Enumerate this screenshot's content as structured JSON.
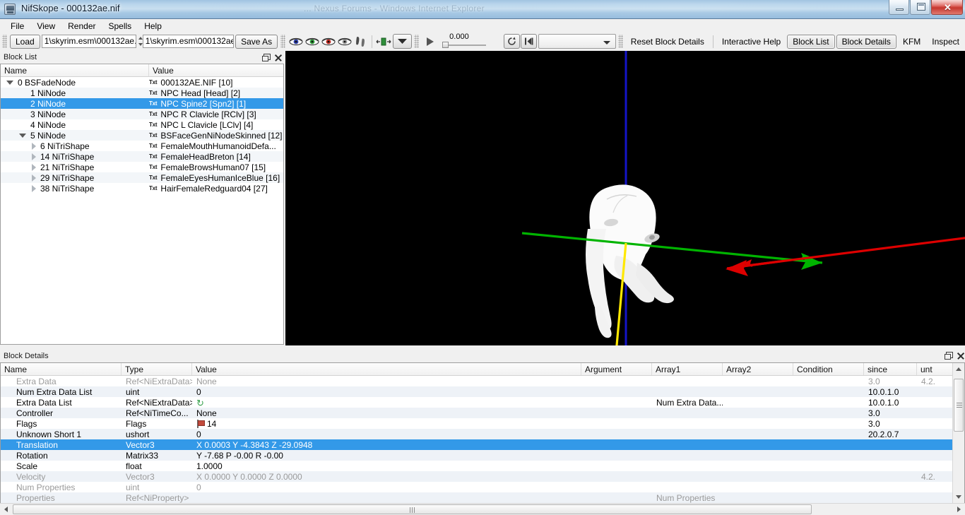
{
  "window": {
    "title": "NifSkope - 000132ae.nif",
    "ghost_text_1": "... Nexus Forums - Windows Internet Explorer",
    "minimize_label": "Minimize",
    "maximize_label": "Restore",
    "close_label": "✕"
  },
  "menubar": {
    "items": [
      {
        "label": "File"
      },
      {
        "label": "View"
      },
      {
        "label": "Render"
      },
      {
        "label": "Spells"
      },
      {
        "label": "Help"
      }
    ]
  },
  "toolbar": {
    "load_label": "Load",
    "path_field_1": "1\\skyrim.esm\\000132ae.nif",
    "path_field_2": "1\\skyrim.esm\\000132ae.nif",
    "saveas_label": "Save As",
    "anim_value": "0.000",
    "anim_combo_value": "",
    "reset_block_details_label": "Reset Block Details",
    "interactive_help_label": "Interactive Help",
    "block_list_label": "Block List",
    "block_details_label": "Block Details",
    "kfm_label": "KFM",
    "inspect_label": "Inspect",
    "icons": [
      "eye-blue-icon",
      "eye-green-icon",
      "eye-red-icon",
      "eye-gray-icon",
      "footsteps-icon",
      "axes-center-icon",
      "dropdown-arrow-icon",
      "play-icon",
      "loop-icon",
      "playpause-icon"
    ]
  },
  "block_list": {
    "panel_title": "Block List",
    "columns": [
      "Name",
      "Value"
    ],
    "rows": [
      {
        "indent": 0,
        "toggle": "open",
        "name": "0 BSFadeNode",
        "value": "000132AE.NIF [10]",
        "badge": "Txt",
        "selected": false
      },
      {
        "indent": 1,
        "toggle": "none",
        "name": "1 NiNode",
        "value": "NPC Head [Head] [2]",
        "badge": "Txt",
        "selected": false
      },
      {
        "indent": 1,
        "toggle": "none",
        "name": "2 NiNode",
        "value": "NPC Spine2 [Spn2] [1]",
        "badge": "Txt",
        "selected": true
      },
      {
        "indent": 1,
        "toggle": "none",
        "name": "3 NiNode",
        "value": "NPC R Clavicle [RClv] [3]",
        "badge": "Txt",
        "selected": false
      },
      {
        "indent": 1,
        "toggle": "none",
        "name": "4 NiNode",
        "value": "NPC L Clavicle [LClv] [4]",
        "badge": "Txt",
        "selected": false
      },
      {
        "indent": 1,
        "toggle": "open",
        "name": "5 NiNode",
        "value": "BSFaceGenNiNodeSkinned [12]",
        "badge": "Txt",
        "selected": false
      },
      {
        "indent": 2,
        "toggle": "closed",
        "name": "6 NiTriShape",
        "value": "FemaleMouthHumanoidDefa...",
        "badge": "Txt",
        "selected": false
      },
      {
        "indent": 2,
        "toggle": "closed",
        "name": "14 NiTriShape",
        "value": "FemaleHeadBreton [14]",
        "badge": "Txt",
        "selected": false
      },
      {
        "indent": 2,
        "toggle": "closed",
        "name": "21 NiTriShape",
        "value": "FemaleBrowsHuman07 [15]",
        "badge": "Txt",
        "selected": false
      },
      {
        "indent": 2,
        "toggle": "closed",
        "name": "29 NiTriShape",
        "value": "FemaleEyesHumanIceBlue [16]",
        "badge": "Txt",
        "selected": false
      },
      {
        "indent": 2,
        "toggle": "closed",
        "name": "38 NiTriShape",
        "value": "HairFemaleRedguard04 [27]",
        "badge": "Txt",
        "selected": false
      }
    ]
  },
  "block_details": {
    "panel_title": "Block Details",
    "columns": [
      "Name",
      "Type",
      "Value",
      "Argument",
      "Array1",
      "Array2",
      "Condition",
      "since",
      "unt"
    ],
    "rows": [
      {
        "name": "Extra Data",
        "type": "Ref<NiExtraData>",
        "value": "None",
        "icon": "",
        "argument": "",
        "array1": "",
        "array2": "",
        "condition": "",
        "since": "3.0",
        "until": "4.2.",
        "dim": true,
        "selected": false
      },
      {
        "name": "Num Extra Data List",
        "type": "uint",
        "value": "0",
        "icon": "",
        "argument": "",
        "array1": "",
        "array2": "",
        "condition": "",
        "since": "10.0.1.0",
        "until": "",
        "dim": false,
        "selected": false
      },
      {
        "name": "Extra Data List",
        "type": "Ref<NiExtraData>",
        "value": "",
        "icon": "refresh",
        "argument": "",
        "array1": "Num Extra Data...",
        "array2": "",
        "condition": "",
        "since": "10.0.1.0",
        "until": "",
        "dim": false,
        "selected": false
      },
      {
        "name": "Controller",
        "type": "Ref<NiTimeCo...",
        "value": "None",
        "icon": "",
        "argument": "",
        "array1": "",
        "array2": "",
        "condition": "",
        "since": "3.0",
        "until": "",
        "dim": false,
        "selected": false
      },
      {
        "name": "Flags",
        "type": "Flags",
        "value": "14",
        "icon": "flag",
        "argument": "",
        "array1": "",
        "array2": "",
        "condition": "",
        "since": "3.0",
        "until": "",
        "dim": false,
        "selected": false
      },
      {
        "name": "Unknown Short 1",
        "type": "ushort",
        "value": "0",
        "icon": "",
        "argument": "",
        "array1": "",
        "array2": "",
        "condition": "",
        "since": "20.2.0.7",
        "until": "",
        "dim": false,
        "selected": false
      },
      {
        "name": "Translation",
        "type": "Vector3",
        "value": "X 0.0003 Y -4.3843 Z -29.0948",
        "icon": "",
        "argument": "",
        "array1": "",
        "array2": "",
        "condition": "",
        "since": "",
        "until": "",
        "dim": false,
        "selected": true
      },
      {
        "name": "Rotation",
        "type": "Matrix33",
        "value": "Y -7.68 P -0.00 R -0.00",
        "icon": "",
        "argument": "",
        "array1": "",
        "array2": "",
        "condition": "",
        "since": "",
        "until": "",
        "dim": false,
        "selected": false
      },
      {
        "name": "Scale",
        "type": "float",
        "value": "1.0000",
        "icon": "",
        "argument": "",
        "array1": "",
        "array2": "",
        "condition": "",
        "since": "",
        "until": "",
        "dim": false,
        "selected": false
      },
      {
        "name": "Velocity",
        "type": "Vector3",
        "value": "X 0.0000 Y 0.0000 Z 0.0000",
        "icon": "",
        "argument": "",
        "array1": "",
        "array2": "",
        "condition": "",
        "since": "",
        "until": "4.2.",
        "dim": true,
        "selected": false
      },
      {
        "name": "Num Properties",
        "type": "uint",
        "value": "0",
        "icon": "",
        "argument": "",
        "array1": "",
        "array2": "",
        "condition": "",
        "since": "",
        "until": "",
        "dim": true,
        "selected": false
      },
      {
        "name": "Properties",
        "type": "Ref<NiProperty>",
        "value": "",
        "icon": "",
        "argument": "",
        "array1": "Num Properties",
        "array2": "",
        "condition": "",
        "since": "",
        "until": "",
        "dim": true,
        "selected": false
      }
    ]
  },
  "viewport": {
    "name": "3d-render-viewport",
    "background_color": "#000000",
    "axis_colors": {
      "x": "#e00000",
      "y": "#00c000",
      "z": "#0000c8",
      "node": "#ffe600"
    },
    "model_color": "#f7f7f7"
  },
  "colors": {
    "selection_blue": "#3399e8",
    "panel_bg": "#f0f0f0",
    "alt_row": "#eef2f7"
  }
}
